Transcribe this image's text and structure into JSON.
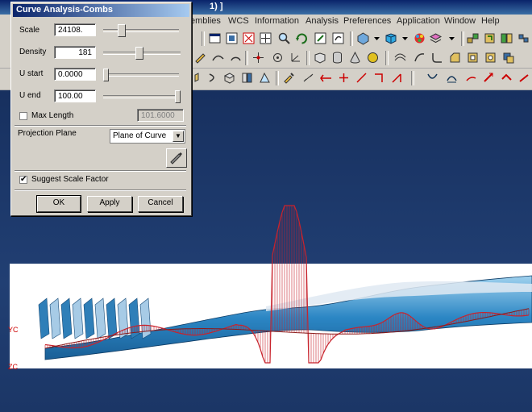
{
  "app": {
    "title_fragment": "1) ]"
  },
  "menu": {
    "items": [
      "emblies",
      "WCS",
      "Information",
      "Analysis",
      "Preferences",
      "Application",
      "Window",
      "Help"
    ]
  },
  "viewport": {
    "labels": {
      "yc": "YC",
      "zc": "ZC"
    }
  },
  "dialog": {
    "title": "Curve Analysis-Combs",
    "scale_label": "Scale",
    "scale_value": "24108.",
    "density_label": "Density",
    "density_value": "181",
    "ustart_label": "U start",
    "ustart_value": "0.0000",
    "uend_label": "U end",
    "uend_value": "100.00",
    "maxlength_label": "Max Length",
    "maxlength_value": "101.6000",
    "maxlength_checked": false,
    "projection_label": "Projection Plane",
    "projection_value": "Plane of Curve",
    "suggest_label": "Suggest Scale Factor",
    "suggest_checked": true,
    "ok_label": "OK",
    "apply_label": "Apply",
    "cancel_label": "Cancel"
  },
  "colors": {
    "comb": "#c8232c",
    "bristle": "#2f7fb8",
    "handle": "#3e9bd0"
  }
}
